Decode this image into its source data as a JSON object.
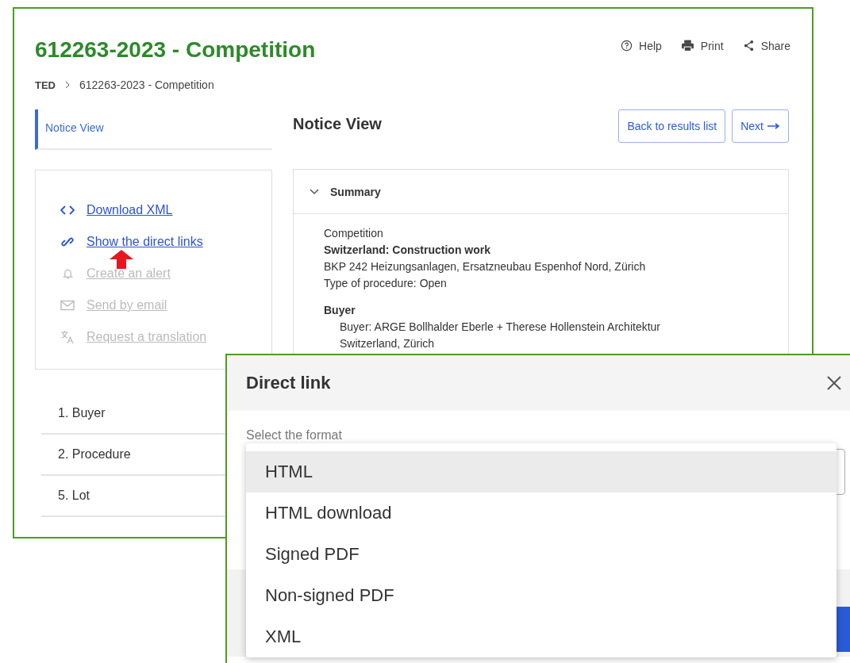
{
  "page": {
    "title": "612263-2023 - Competition",
    "header_actions": [
      {
        "kind": "help",
        "label": "Help"
      },
      {
        "kind": "print",
        "label": "Print"
      },
      {
        "kind": "share",
        "label": "Share"
      }
    ],
    "breadcrumb": [
      "TED",
      "612263-2023 - Competition"
    ],
    "side_nav": [
      {
        "label": "Notice View",
        "selected": true
      }
    ],
    "actions": [
      {
        "kind": "code",
        "label": "Download XML",
        "disabled": false
      },
      {
        "kind": "link",
        "label": "Show the direct links",
        "disabled": false
      },
      {
        "kind": "bell",
        "label": "Create an alert",
        "disabled": true
      },
      {
        "kind": "mail",
        "label": "Send by email",
        "disabled": true
      },
      {
        "kind": "translate",
        "label": "Request a translation",
        "disabled": true
      }
    ],
    "sections": [
      "1. Buyer",
      "2. Procedure",
      "5. Lot"
    ],
    "heading": "Notice View",
    "buttons": [
      {
        "label": "Back to results list",
        "kind": "plain"
      },
      {
        "label": "Next",
        "kind": "forward"
      }
    ],
    "summary": {
      "title": "Summary",
      "expanded": true,
      "lines": [
        {
          "kind": "text",
          "text": "Competition"
        },
        {
          "kind": "bold",
          "text": "Switzerland: Construction work"
        },
        {
          "kind": "text",
          "text": "BKP 242 Heizungsanlagen, Ersatzneubau Espenhof Nord, Zürich"
        },
        {
          "kind": "text",
          "text": "Type of procedure: Open"
        },
        {
          "kind": "heading",
          "text": "Buyer"
        },
        {
          "kind": "indent",
          "text": "Buyer: ARGE Bollhalder Eberle + Therese Hollenstein Architektur"
        },
        {
          "kind": "indent",
          "text": "Switzerland, Zürich"
        }
      ]
    }
  },
  "dialog": {
    "title": "Direct link",
    "field_label": "Select the format",
    "options": [
      {
        "label": "HTML",
        "selected": true
      },
      {
        "label": "HTML download",
        "selected": false
      },
      {
        "label": "Signed PDF",
        "selected": false
      },
      {
        "label": "Non-signed PDF",
        "selected": false
      },
      {
        "label": "XML",
        "selected": false
      }
    ]
  }
}
